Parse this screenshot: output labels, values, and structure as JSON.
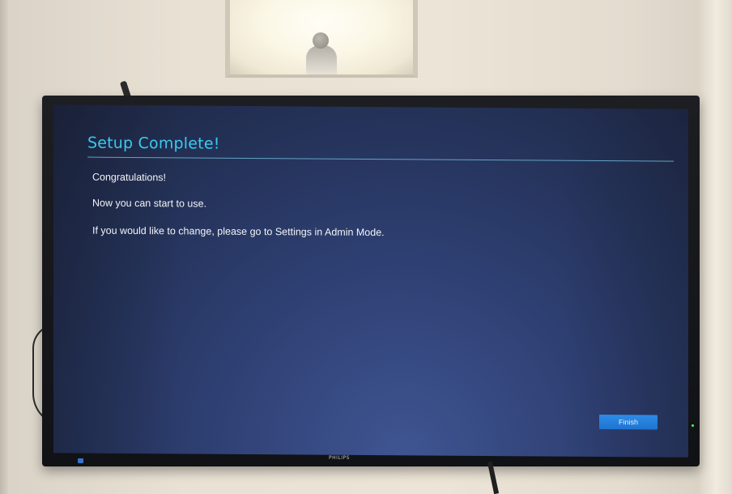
{
  "dialog": {
    "title": "Setup Complete!",
    "lines": [
      "Congratulations!",
      "Now you can start to use.",
      "If you would like to change, please go to Settings in Admin Mode."
    ],
    "finish_label": "Finish"
  },
  "monitor": {
    "brand": "PHILIPS"
  },
  "colors": {
    "title": "#3bc9f0",
    "button": "#2d8ce6",
    "screen_background": "#2e3f72"
  }
}
